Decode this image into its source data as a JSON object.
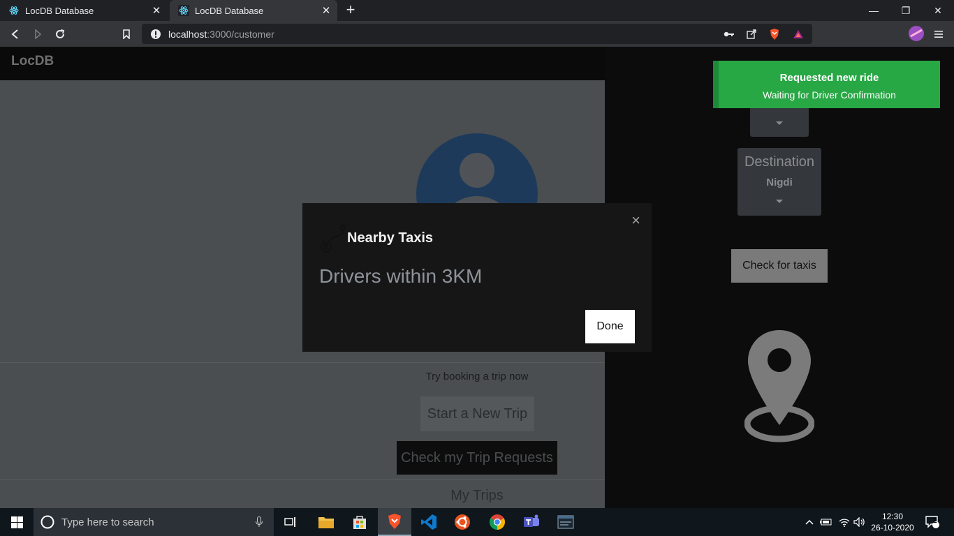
{
  "browser": {
    "tabs": [
      {
        "title": "LocDB Database",
        "active": false
      },
      {
        "title": "LocDB Database",
        "active": true
      }
    ],
    "url_host": "localhost",
    "url_path": ":3000/customer",
    "window_controls": [
      "minimize",
      "restore",
      "close"
    ]
  },
  "app": {
    "brand": "LocDB",
    "try_text": "Try booking a trip now",
    "start_trip_label": "Start a New Trip",
    "check_requests_label": "Check my Trip Requests",
    "my_trips_label": "My Trips"
  },
  "right_panel": {
    "destination_label": "Destination",
    "destination_value": "Nigdi",
    "check_taxis_label": "Check for taxis"
  },
  "toast": {
    "title": "Requested new ride",
    "message": "Waiting for Driver Confirmation",
    "color": "#28a745"
  },
  "modal": {
    "title": "Nearby Taxis",
    "body": "Drivers within 3KM",
    "done_label": "Done",
    "close_glyph": "×"
  },
  "taskbar": {
    "search_placeholder": "Type here to search",
    "time": "12:30",
    "date": "26-10-2020",
    "notification_count": "2"
  }
}
